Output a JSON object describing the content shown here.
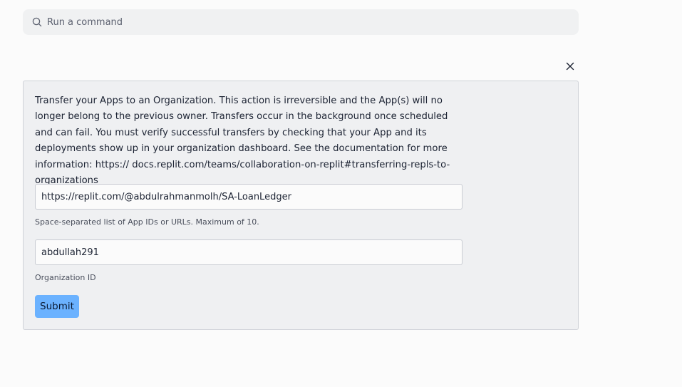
{
  "command_bar": {
    "placeholder": "Run a command",
    "icon": "search-icon"
  },
  "dialog": {
    "close_icon": "close-icon",
    "description": "Transfer your Apps to an Organization. This action is irreversible and the App(s) will no longer belong to the previous owner. Transfers occur in the background once scheduled and can fail. You must verify successful transfers by checking that your App and its deployments show up in your organization dashboard. See the documentation for more information: https:// docs.replit.com/teams/collaboration-on-replit#transferring-repls-to-organizations",
    "apps_field": {
      "value": "https://replit.com/@abdulrahmanmolh/SA-LoanLedger",
      "hint": "Space-separated list of App IDs or URLs. Maximum of 10."
    },
    "org_field": {
      "value": "abdullah291",
      "hint": "Organization ID"
    },
    "submit_label": "Submit"
  },
  "colors": {
    "accent": "#6bb2ff",
    "panel_bg": "#eff0f2",
    "page_bg": "#fbfbfb"
  }
}
